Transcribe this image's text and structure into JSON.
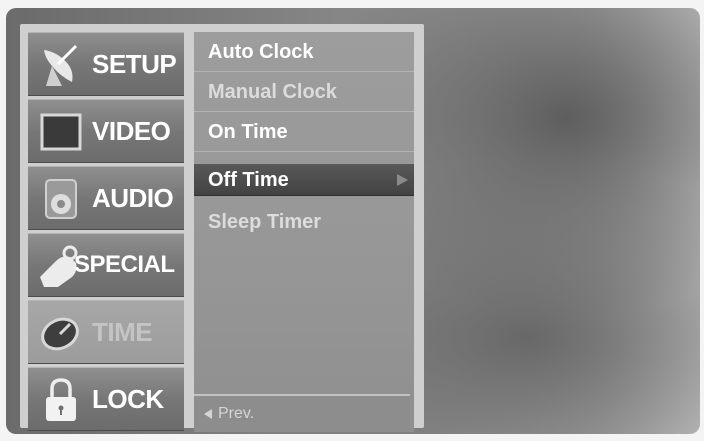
{
  "sidebar": {
    "items": [
      {
        "label": "SETUP",
        "icon": "satellite-dish-icon",
        "active": true
      },
      {
        "label": "VIDEO",
        "icon": "screen-icon",
        "active": true
      },
      {
        "label": "AUDIO",
        "icon": "speaker-icon",
        "active": true
      },
      {
        "label": "SPECIAL",
        "icon": "tag-icon",
        "active": true
      },
      {
        "label": "TIME",
        "icon": "clock-icon",
        "active": false
      },
      {
        "label": "LOCK",
        "icon": "padlock-icon",
        "active": true
      }
    ]
  },
  "menu": {
    "items": [
      {
        "label": "Auto Clock"
      },
      {
        "label": "Manual Clock"
      },
      {
        "label": "On Time"
      },
      {
        "label": "Off Time",
        "selected": true
      },
      {
        "label": "Sleep Timer"
      }
    ],
    "prev_label": "Prev."
  }
}
